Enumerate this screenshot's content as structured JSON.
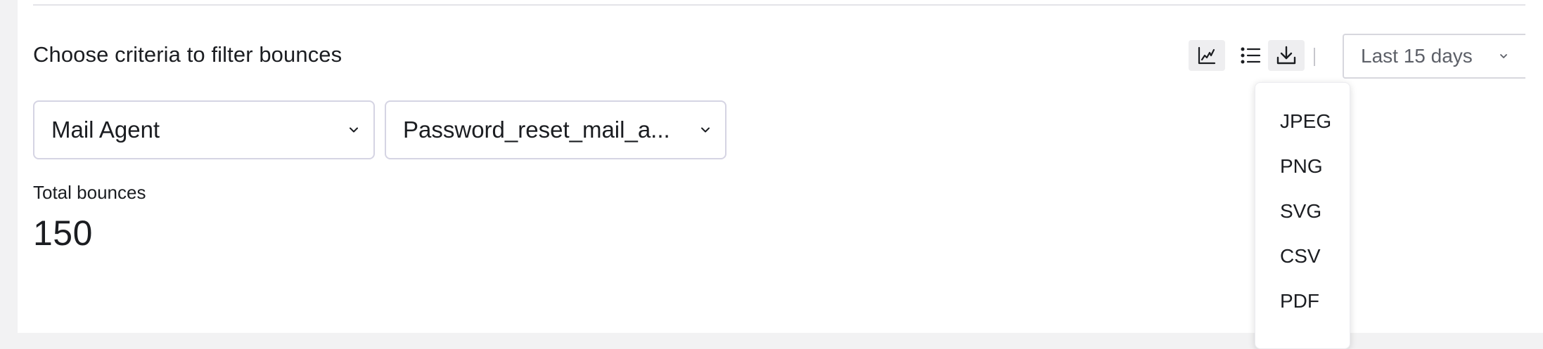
{
  "section": {
    "title": "Choose criteria to filter bounces"
  },
  "filters": {
    "agent": {
      "value": "Mail Agent",
      "icon": "chevron-down-icon"
    },
    "template": {
      "value": "Password_reset_mail_a...",
      "icon": "chevron-down-icon"
    }
  },
  "stats": {
    "total_label": "Total bounces",
    "total_value": "150"
  },
  "toolbar": {
    "chart_icon": "line-chart-icon",
    "list_icon": "list-icon",
    "download_icon": "download-icon",
    "date_range": "Last 15 days"
  },
  "download_menu": {
    "items": [
      "JPEG",
      "PNG",
      "SVG",
      "CSV",
      "PDF"
    ]
  },
  "colors": {
    "text": "#1b1d21",
    "border": "#d5d4e3",
    "active_button_bg": "#eeeef0",
    "page_bg": "#f2f2f3"
  }
}
